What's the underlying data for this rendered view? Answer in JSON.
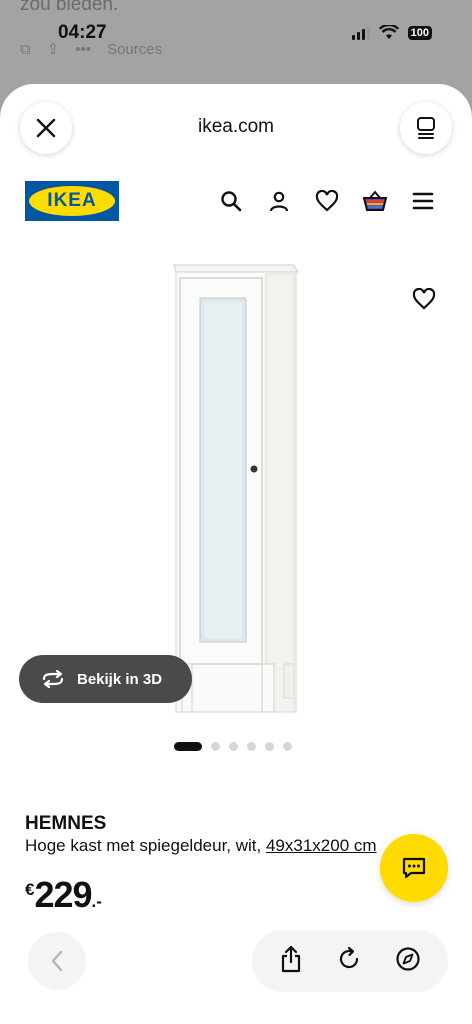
{
  "background": {
    "partial_text": "zou bieden.",
    "toolbar_label": "Sources"
  },
  "status_bar": {
    "time": "04:27",
    "battery": "100"
  },
  "browser": {
    "url": "ikea.com"
  },
  "brand": {
    "logo_text": "IKEA",
    "logo_blue": "#0058a3",
    "logo_yellow": "#ffdb00"
  },
  "nav": {
    "icons": [
      "search-icon",
      "account-icon",
      "heart-icon",
      "basket-icon",
      "menu-icon"
    ]
  },
  "product": {
    "name": "HEMNES",
    "description": "Hoge kast met spiegeldeur, wit, ",
    "dimensions": "49x31x200 cm",
    "currency": "€",
    "price": "229",
    "price_suffix": ".-",
    "view_3d_label": "Bekijk in 3D",
    "image_count": 6,
    "active_image": 1
  },
  "colors": {
    "accent_yellow": "#ffdb00",
    "dark_button": "#4a4a4a"
  }
}
